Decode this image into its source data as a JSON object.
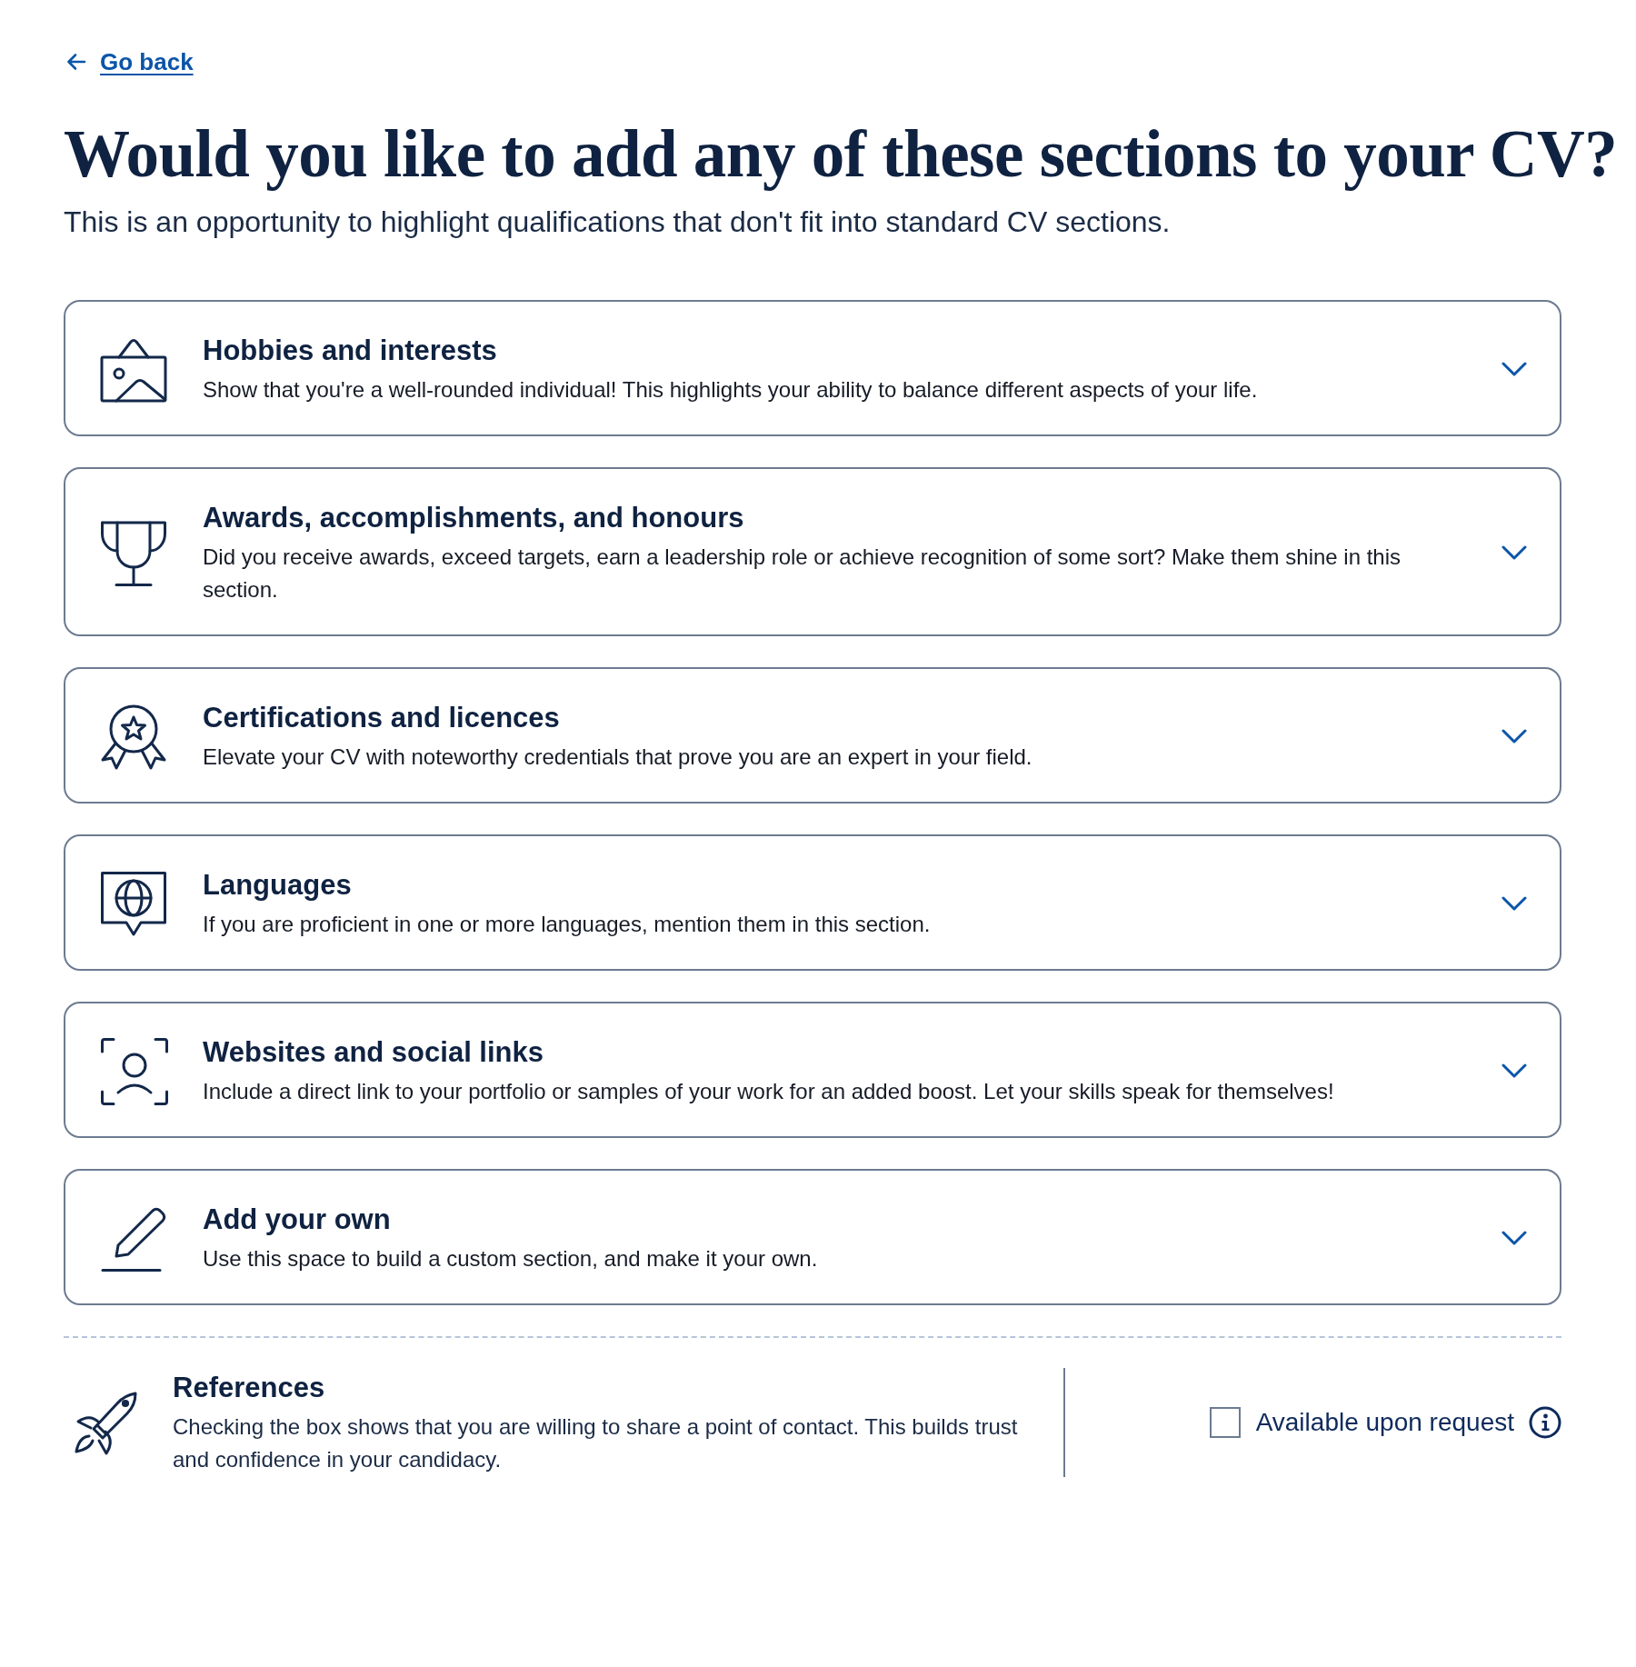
{
  "back_link": {
    "label": "Go back"
  },
  "heading": "Would you like to add any of these sections to your CV?",
  "subheading": "This is an opportunity to highlight qualifications that don't fit into standard CV sections.",
  "sections": [
    {
      "title": "Hobbies and interests",
      "description": "Show that you're a well-rounded individual! This highlights your ability to balance different aspects of your life.",
      "expanded": false
    },
    {
      "title": "Awards, accomplishments, and honours",
      "description": "Did you receive awards, exceed targets, earn a leadership role or achieve recognition of some sort? Make them shine in this section.",
      "expanded": false
    },
    {
      "title": "Certifications and licences",
      "description": "Elevate your CV with noteworthy credentials that prove you are an expert in your field.",
      "expanded": false
    },
    {
      "title": "Languages",
      "description": "If you are proficient in one or more languages, mention them in this section.",
      "expanded": false
    },
    {
      "title": "Websites and social links",
      "description": "Include a direct link to your portfolio or samples of your work for an added boost. Let your skills speak for themselves!",
      "expanded": false
    },
    {
      "title": "Add your own",
      "description": "Use this space to build a custom section, and make it your own.",
      "expanded": false
    }
  ],
  "references": {
    "title": "References",
    "description": "Checking the box shows that you are willing to share a point of contact. This builds trust and confidence in your candidacy.",
    "checkbox": {
      "label": "Available upon request",
      "checked": false
    }
  }
}
